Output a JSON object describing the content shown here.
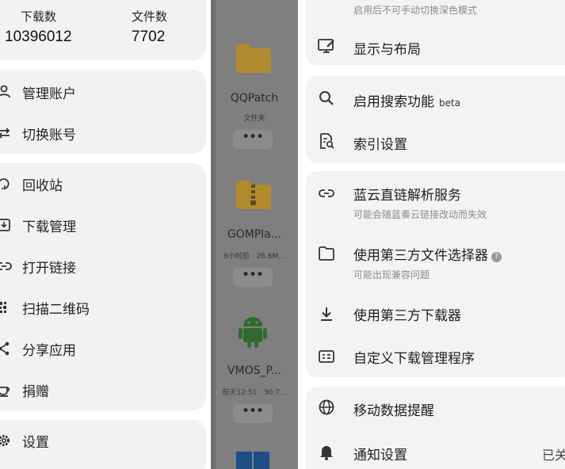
{
  "drawer": {
    "stats": {
      "downloads_label": "下载数",
      "downloads_value": "10396012",
      "files_label": "文件数",
      "files_value": "7702"
    },
    "account": [
      {
        "icon": "person-icon",
        "label": "管理账户"
      },
      {
        "icon": "swap-icon",
        "label": "切换账号"
      }
    ],
    "tools": [
      {
        "icon": "recycle-icon",
        "label": "回收站"
      },
      {
        "icon": "download-box-icon",
        "label": "下载管理"
      },
      {
        "icon": "link-icon",
        "label": "打开链接"
      },
      {
        "icon": "qrcode-icon",
        "label": "扫描二维码"
      },
      {
        "icon": "share-icon",
        "label": "分享应用"
      },
      {
        "icon": "coffee-icon",
        "label": "捐赠"
      }
    ],
    "settings": {
      "icon": "gear-icon",
      "label": "设置"
    }
  },
  "files": [
    {
      "icon": "folder-icon",
      "name": "QQPatch",
      "meta": "文件夹",
      "more": "•••"
    },
    {
      "icon": "zip-folder-icon",
      "name": "GOMPla...",
      "meta": "8小时前 · 26.6M...",
      "more": "•••"
    },
    {
      "icon": "android-icon",
      "name": "VMOS_P...",
      "meta": "前天12:51 · 30.7...",
      "more": "•••"
    }
  ],
  "settings": {
    "top_subtitle": "启用后不可手动切换深色模式",
    "display_layout": "显示与布局",
    "search": {
      "title": "启用搜索功能",
      "badge": "beta"
    },
    "index": "索引设置",
    "lanyun": {
      "title": "蓝云直链解析服务",
      "subtitle": "可能会随蓝奏云链接改动而失效"
    },
    "third_picker": {
      "title": "使用第三方文件选择器",
      "help": "?",
      "subtitle": "可能出现兼容问题"
    },
    "third_downloader": "使用第三方下载器",
    "custom_dl_manager": "自定义下载管理程序",
    "mobile_data": "移动数据提醒",
    "notification": {
      "title": "通知设置",
      "value": "已关闭"
    }
  },
  "colors": {
    "card_bg": "#f2f2f4",
    "dim_overlay": "#7f7f7f",
    "folder_yellow": "#e6b43a",
    "android_green": "#3a8a3a",
    "windows_blue": "#1f6fc9"
  }
}
